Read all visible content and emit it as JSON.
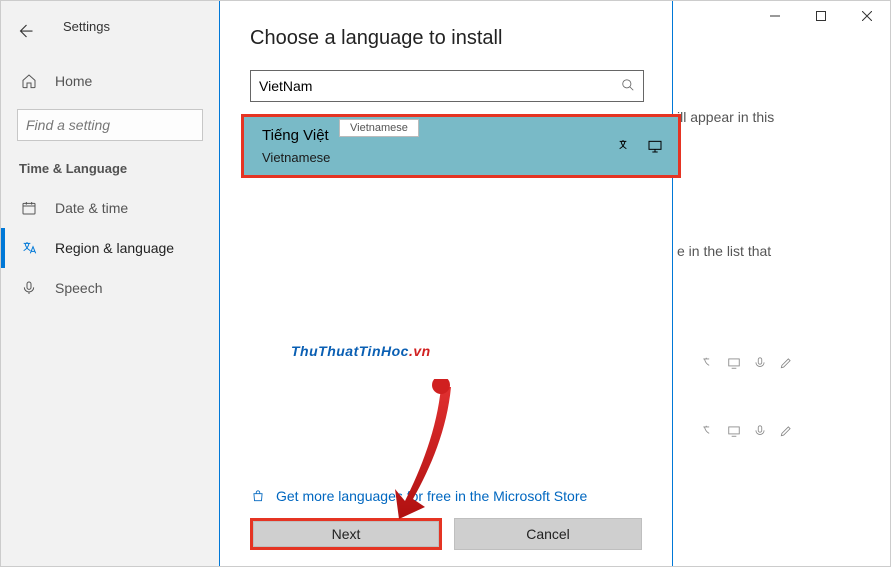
{
  "app": {
    "title": "Settings"
  },
  "sidebar": {
    "home": "Home",
    "search_placeholder": "Find a setting",
    "category": "Time & Language",
    "items": [
      {
        "label": "Date & time"
      },
      {
        "label": "Region & language"
      },
      {
        "label": "Speech"
      }
    ]
  },
  "dialog": {
    "title": "Choose a language to install",
    "search_value": "VietNam",
    "tooltip": "Vietnamese",
    "result": {
      "native": "Tiếng Việt",
      "english": "Vietnamese"
    },
    "store_link": "Get more languages for free in the Microsoft Store",
    "next": "Next",
    "cancel": "Cancel"
  },
  "background": {
    "line1": "ill appear in this",
    "line2": "e in the list that"
  },
  "watermark": {
    "part1": "ThuThuatTinHoc",
    "part2": ".vn"
  }
}
